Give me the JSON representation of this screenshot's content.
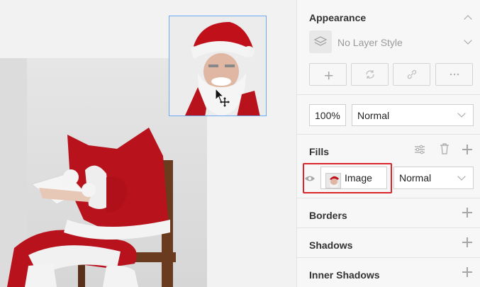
{
  "panel": {
    "appearance": {
      "title": "Appearance",
      "layer_style": "No Layer Style"
    },
    "opacity": "100%",
    "blend_mode": "Normal",
    "fills": {
      "title": "Fills",
      "fill_type": "Image",
      "fill_blend": "Normal"
    },
    "borders": {
      "title": "Borders"
    },
    "shadows": {
      "title": "Shadows"
    },
    "inner_shadows": {
      "title": "Inner Shadows"
    }
  },
  "colors": {
    "selection_border": "#6aaaf0",
    "highlight_border": "#d9262c",
    "santa_red": "#b8121c"
  }
}
